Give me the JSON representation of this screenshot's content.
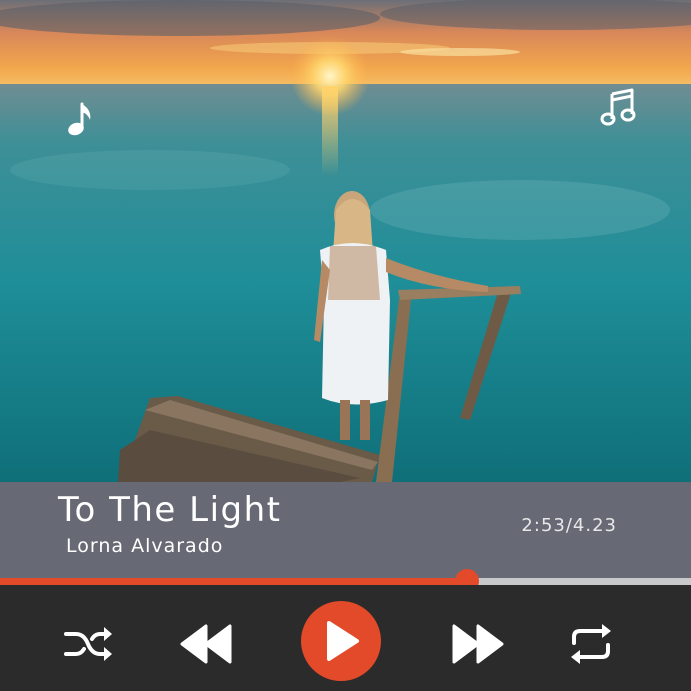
{
  "player": {
    "song_title": "To The Light",
    "artist": "Lorna Alvarado",
    "time_display": "2:53/4.23",
    "progress": 0.676
  },
  "colors": {
    "accent": "#e24a2a",
    "info_bar": "#676a74",
    "controls_bg": "#2b2b2b",
    "track": "#c9c9cc"
  },
  "icons": {
    "left_decoration": "music-note-icon",
    "right_decoration": "beamed-notes-icon",
    "shuffle": "shuffle-icon",
    "rewind": "rewind-icon",
    "play": "play-icon",
    "forward": "fast-forward-icon",
    "repeat": "repeat-icon"
  }
}
